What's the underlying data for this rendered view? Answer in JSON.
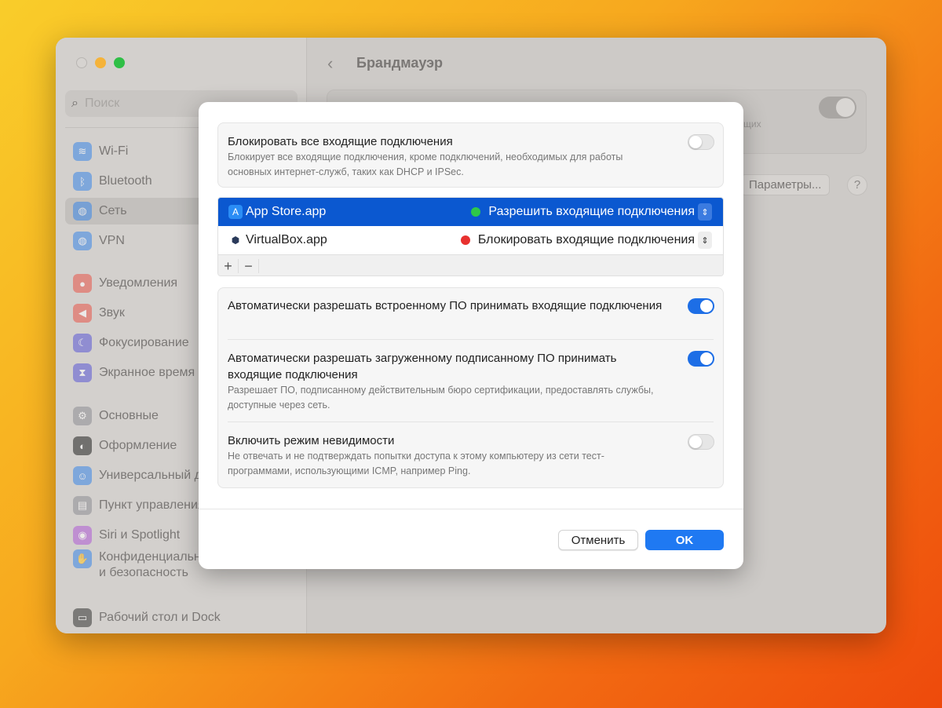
{
  "window": {
    "search_placeholder": "Поиск",
    "sidebar": [
      {
        "label": "Wi-Fi",
        "icon": "wifi-icon",
        "color": "#3a86e8"
      },
      {
        "label": "Bluetooth",
        "icon": "bluetooth-icon",
        "color": "#3a86e8"
      },
      {
        "label": "Сеть",
        "icon": "globe-icon",
        "color": "#3a86e8",
        "selected": true
      },
      {
        "label": "VPN",
        "icon": "globe-icon",
        "color": "#3a86e8"
      },
      {
        "label": "Уведомления",
        "icon": "bell-icon",
        "color": "#e8554a"
      },
      {
        "label": "Звук",
        "icon": "speaker-icon",
        "color": "#e8554a"
      },
      {
        "label": "Фокусирование",
        "icon": "moon-icon",
        "color": "#5b58d6"
      },
      {
        "label": "Экранное время",
        "icon": "hourglass-icon",
        "color": "#5b58d6"
      },
      {
        "label": "Основные",
        "icon": "gear-icon",
        "color": "#8e8e93"
      },
      {
        "label": "Оформление",
        "icon": "appearance-icon",
        "color": "#222222"
      },
      {
        "label": "Универсальный доступ",
        "icon": "accessibility-icon",
        "color": "#3a86e8"
      },
      {
        "label": "Пункт управления",
        "icon": "control-center-icon",
        "color": "#8e8e93"
      },
      {
        "label": "Siri и Spotlight",
        "icon": "siri-icon",
        "color": "#b05ad6"
      },
      {
        "label": "Конфиденциальность и безопасность",
        "icon": "hand-icon",
        "color": "#3a86e8"
      },
      {
        "label": "Рабочий стол и Dock",
        "icon": "dock-icon",
        "color": "#333333"
      }
    ],
    "title": "Брандмауэр",
    "bg_partial_text": "щих",
    "params_button": "Параметры...",
    "help_button": "?"
  },
  "dialog": {
    "block_all": {
      "title": "Блокировать все входящие подключения",
      "desc": "Блокирует все входящие подключения, кроме подключений, необходимых для работы основных интернет-служб, таких как DHCP и IPSec.",
      "enabled": false
    },
    "apps": [
      {
        "name": "App Store.app",
        "rule": "Разрешить входящие подключения",
        "status_color": "#2ec84a",
        "selected": true
      },
      {
        "name": "VirtualBox.app",
        "rule": "Блокировать входящие подключения",
        "status_color": "#e8312f",
        "selected": false
      }
    ],
    "add_label": "+",
    "remove_label": "−",
    "options": [
      {
        "title": "Автоматически разрешать встроенному ПО принимать входящие подключения",
        "desc": "",
        "enabled": true
      },
      {
        "title": "Автоматически разрешать загруженному подписанному ПО принимать входящие подключения",
        "desc": "Разрешает ПО, подписанному действительным бюро сертификации, предоставлять службы, доступные через сеть.",
        "enabled": true
      },
      {
        "title": "Включить режим невидимости",
        "desc": "Не отвечать и не подтверждать попытки доступа к этому компьютеру из сети тест-программами, использующими ICMP, например Ping.",
        "enabled": false
      }
    ],
    "cancel_label": "Отменить",
    "ok_label": "OK"
  }
}
